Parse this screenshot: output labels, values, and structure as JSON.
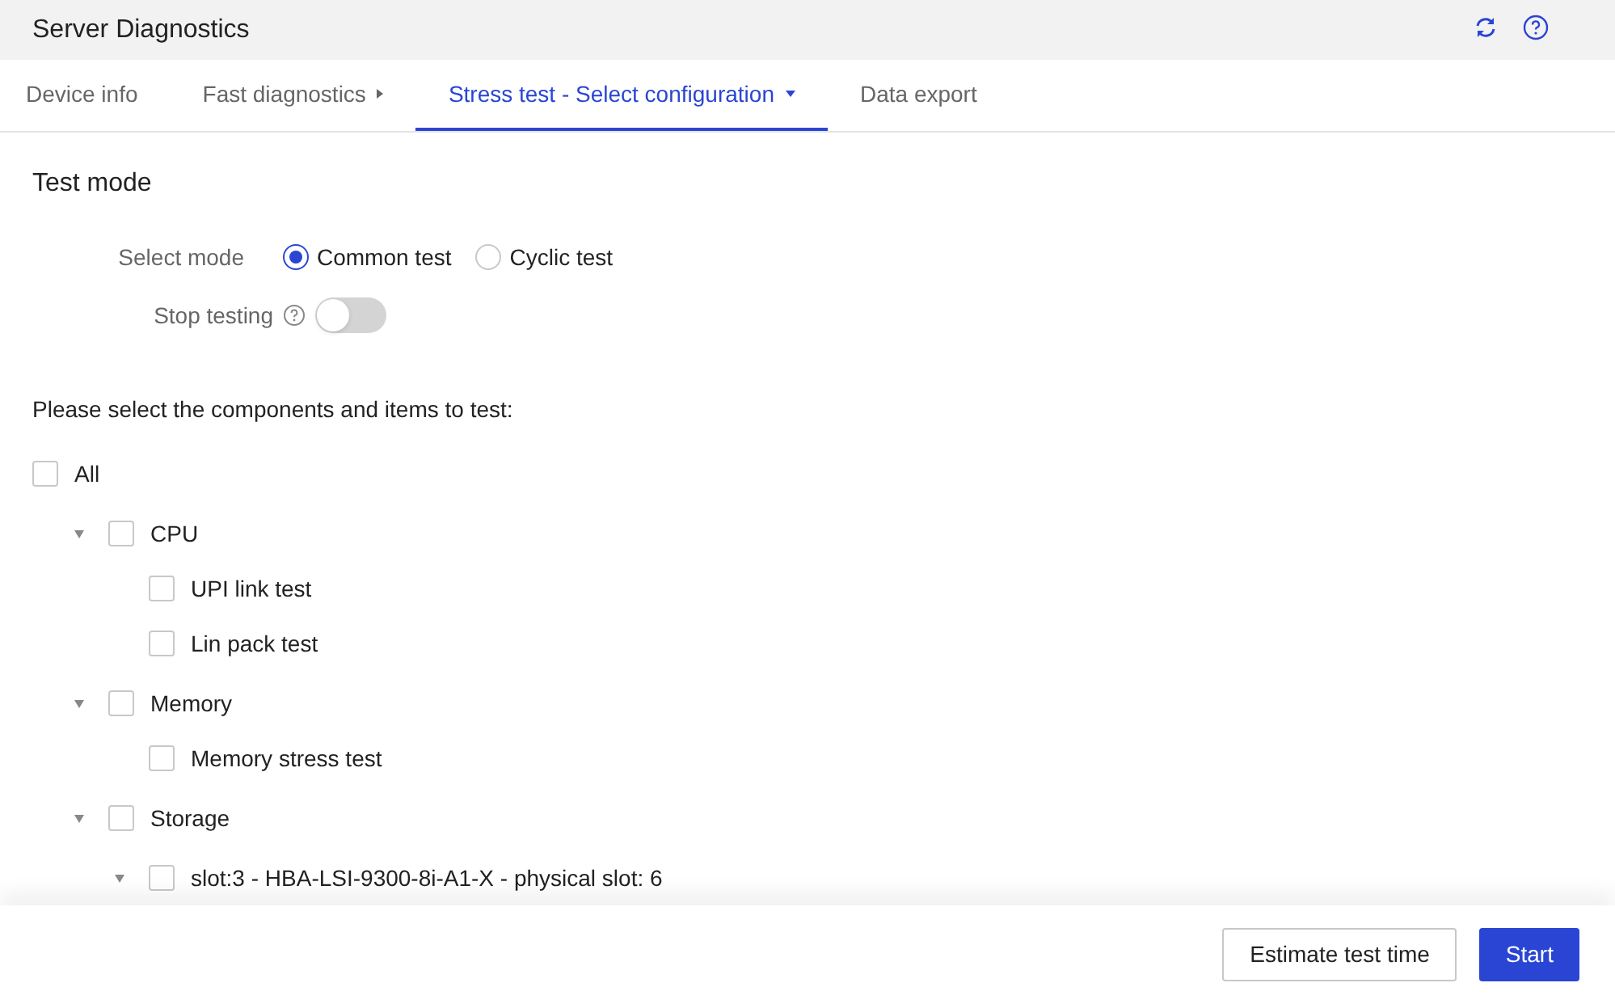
{
  "window": {
    "title": "Server Diagnostics"
  },
  "tabs": [
    {
      "label": "Device info",
      "selected": false,
      "kind": "plain"
    },
    {
      "label": "Fast diagnostics",
      "selected": false,
      "kind": "submenu"
    },
    {
      "label": "Stress test - Select configuration",
      "selected": true,
      "kind": "dropdown"
    },
    {
      "label": "Data export",
      "selected": false,
      "kind": "plain"
    }
  ],
  "section_title": "Test mode",
  "mode": {
    "label": "Select mode",
    "options": [
      {
        "label": "Common test",
        "selected": true
      },
      {
        "label": "Cyclic test",
        "selected": false
      }
    ]
  },
  "stop_testing": {
    "label": "Stop testing",
    "on": false
  },
  "prompt": "Please select the components and items to test:",
  "tree": {
    "label": "All",
    "checked": false,
    "children": [
      {
        "label": "CPU",
        "checked": false,
        "expanded": true,
        "children": [
          {
            "label": "UPI link test",
            "checked": false
          },
          {
            "label": "Lin pack test",
            "checked": false
          }
        ]
      },
      {
        "label": "Memory",
        "checked": false,
        "expanded": true,
        "children": [
          {
            "label": "Memory stress test",
            "checked": false
          }
        ]
      },
      {
        "label": "Storage",
        "checked": false,
        "expanded": true,
        "children": [
          {
            "label": "slot:3 - HBA-LSI-9300-8i-A1-X - physical slot: 6",
            "checked": false,
            "expanded": true
          }
        ]
      }
    ]
  },
  "buttons": [
    {
      "label": "Estimate test time",
      "kind": "secondary"
    },
    {
      "label": "Start",
      "kind": "primary"
    }
  ]
}
